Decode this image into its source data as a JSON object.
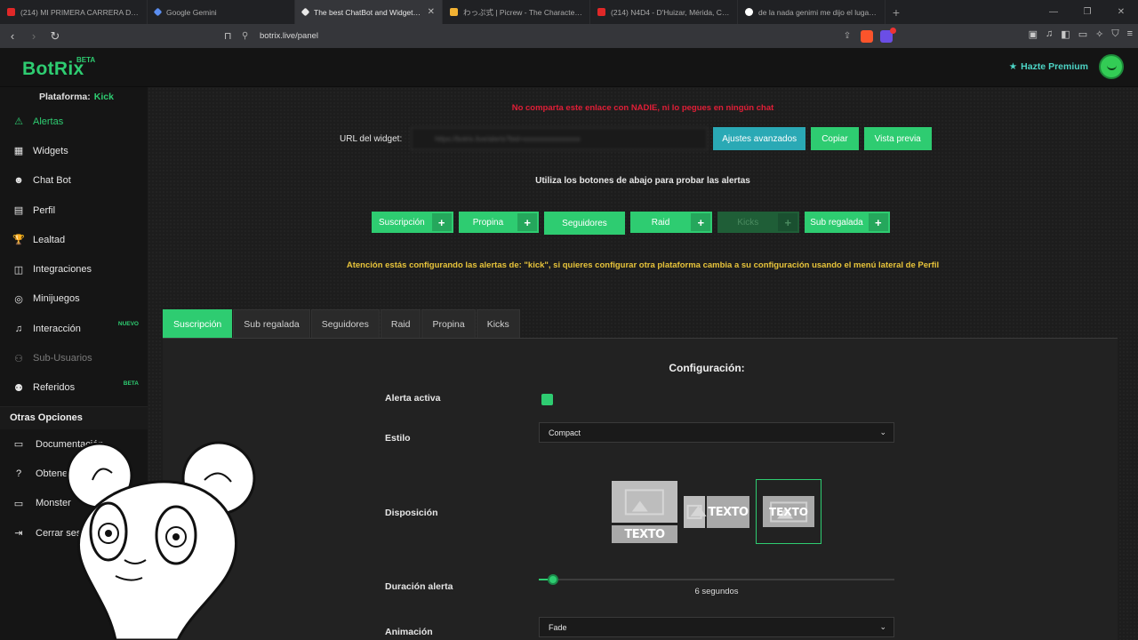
{
  "browser": {
    "tabs": [
      {
        "title": "(214) MI PRIMERA CARRERA DE BOT...",
        "color": "#e02828"
      },
      {
        "title": "Google Gemini",
        "color": "#5b8def"
      },
      {
        "title": "The best ChatBot and Widgets f...",
        "color": "#e8e8e8",
        "close": "✕"
      },
      {
        "title": "わっぷ式 | Picrew - The Character Mak...",
        "color": "#f2b233"
      },
      {
        "title": "(214) N4D4 - D'Huizar, Mérida, Chep...",
        "color": "#e02828"
      },
      {
        "title": "de la nada genimi me dijo el lugar d...",
        "color": "#4c8bf5"
      }
    ],
    "url": "botrix.live/panel"
  },
  "header": {
    "logo": "BotRix",
    "logo_badge": "BETA",
    "premium": "Hazte Premium"
  },
  "sidebar": {
    "platform_label": "Plataforma:",
    "platform_value": "Kick",
    "items": [
      {
        "label": "Alertas",
        "icon": "⚠"
      },
      {
        "label": "Widgets",
        "icon": "▦"
      },
      {
        "label": "Chat Bot",
        "icon": "☻"
      },
      {
        "label": "Perfil",
        "icon": "▤"
      },
      {
        "label": "Lealtad",
        "icon": "🏆"
      },
      {
        "label": "Integraciones",
        "icon": "◫"
      },
      {
        "label": "Minijuegos",
        "icon": "◎"
      },
      {
        "label": "Interacción",
        "icon": "♫",
        "tag": "NUEVO"
      },
      {
        "label": "Sub-Usuarios",
        "icon": "⚇"
      },
      {
        "label": "Referidos",
        "icon": "⚉",
        "tag": "BETA"
      }
    ],
    "other_title": "Otras Opciones",
    "other_items": [
      {
        "label": "Documentación",
        "icon": "▭"
      },
      {
        "label": "Obtener ayuda",
        "icon": "?"
      },
      {
        "label": "Monster",
        "icon": "▭"
      },
      {
        "label": "Cerrar sesión",
        "icon": "⇥"
      }
    ]
  },
  "main": {
    "warning": "No comparta este enlace con NADIE, ni lo pegues en ningún chat",
    "widget_label": "URL del widget:",
    "widget_url": "https://botrix.live/alerts?bid=xxxxxxxxxxxxxxxx",
    "btn_advanced": "Ajustes avanzados",
    "btn_copy": "Copiar",
    "btn_preview": "Vista previa",
    "hint": "Utiliza los botones de abajo para probar las alertas",
    "test_buttons": [
      {
        "label": "Suscripción"
      },
      {
        "label": "Propina"
      },
      {
        "label": "Seguidores"
      },
      {
        "label": "Raid"
      },
      {
        "label": "Kicks"
      },
      {
        "label": "Sub regalada"
      }
    ],
    "attention": "Atención estás configurando las alertas de: \"kick\", si quieres configurar otra plataforma cambia a su configuración usando el menú lateral de Perfil",
    "tabs": [
      "Suscripción",
      "Sub regalada",
      "Seguidores",
      "Raid",
      "Propina",
      "Kicks"
    ],
    "config_title": "Configuración:",
    "field_active": "Alerta activa",
    "field_style": "Estilo",
    "style_value": "Compact",
    "field_layout": "Disposición",
    "layout_text": "TEXTO",
    "field_duration": "Duración alerta",
    "duration_fraction": 0.04,
    "duration_value": "6 segundos",
    "field_animation": "Animación",
    "animation_value": "Fade"
  },
  "colors": {
    "accent": "#2ecc71",
    "teal": "#2aa9b5",
    "danger": "#e01e37",
    "warning": "#e8c43a"
  }
}
